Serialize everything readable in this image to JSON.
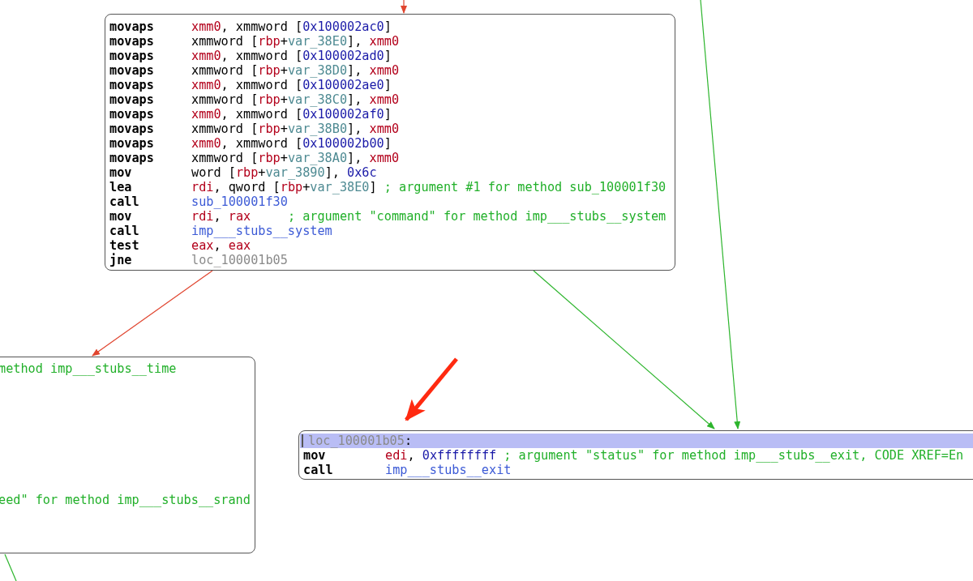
{
  "blocks": [
    {
      "lines": [
        {
          "kind": "instruction",
          "mnemonic": "movaps",
          "operands": [
            {
              "kind": "reg",
              "text": "xmm0"
            },
            {
              "kind": "plain",
              "text": ", xmmword ["
            },
            {
              "kind": "num",
              "text": "0x100002ac0"
            },
            {
              "kind": "plain",
              "text": "]"
            }
          ]
        },
        {
          "kind": "instruction",
          "mnemonic": "movaps",
          "operands": [
            {
              "kind": "plain",
              "text": "xmmword ["
            },
            {
              "kind": "reg",
              "text": "rbp"
            },
            {
              "kind": "plain",
              "text": "+"
            },
            {
              "kind": "var",
              "text": "var_38E0"
            },
            {
              "kind": "plain",
              "text": "], "
            },
            {
              "kind": "reg",
              "text": "xmm0"
            }
          ]
        },
        {
          "kind": "instruction",
          "mnemonic": "movaps",
          "operands": [
            {
              "kind": "reg",
              "text": "xmm0"
            },
            {
              "kind": "plain",
              "text": ", xmmword ["
            },
            {
              "kind": "num",
              "text": "0x100002ad0"
            },
            {
              "kind": "plain",
              "text": "]"
            }
          ]
        },
        {
          "kind": "instruction",
          "mnemonic": "movaps",
          "operands": [
            {
              "kind": "plain",
              "text": "xmmword ["
            },
            {
              "kind": "reg",
              "text": "rbp"
            },
            {
              "kind": "plain",
              "text": "+"
            },
            {
              "kind": "var",
              "text": "var_38D0"
            },
            {
              "kind": "plain",
              "text": "], "
            },
            {
              "kind": "reg",
              "text": "xmm0"
            }
          ]
        },
        {
          "kind": "instruction",
          "mnemonic": "movaps",
          "operands": [
            {
              "kind": "reg",
              "text": "xmm0"
            },
            {
              "kind": "plain",
              "text": ", xmmword ["
            },
            {
              "kind": "num",
              "text": "0x100002ae0"
            },
            {
              "kind": "plain",
              "text": "]"
            }
          ]
        },
        {
          "kind": "instruction",
          "mnemonic": "movaps",
          "operands": [
            {
              "kind": "plain",
              "text": "xmmword ["
            },
            {
              "kind": "reg",
              "text": "rbp"
            },
            {
              "kind": "plain",
              "text": "+"
            },
            {
              "kind": "var",
              "text": "var_38C0"
            },
            {
              "kind": "plain",
              "text": "], "
            },
            {
              "kind": "reg",
              "text": "xmm0"
            }
          ]
        },
        {
          "kind": "instruction",
          "mnemonic": "movaps",
          "operands": [
            {
              "kind": "reg",
              "text": "xmm0"
            },
            {
              "kind": "plain",
              "text": ", xmmword ["
            },
            {
              "kind": "num",
              "text": "0x100002af0"
            },
            {
              "kind": "plain",
              "text": "]"
            }
          ]
        },
        {
          "kind": "instruction",
          "mnemonic": "movaps",
          "operands": [
            {
              "kind": "plain",
              "text": "xmmword ["
            },
            {
              "kind": "reg",
              "text": "rbp"
            },
            {
              "kind": "plain",
              "text": "+"
            },
            {
              "kind": "var",
              "text": "var_38B0"
            },
            {
              "kind": "plain",
              "text": "], "
            },
            {
              "kind": "reg",
              "text": "xmm0"
            }
          ]
        },
        {
          "kind": "instruction",
          "mnemonic": "movaps",
          "operands": [
            {
              "kind": "reg",
              "text": "xmm0"
            },
            {
              "kind": "plain",
              "text": ", xmmword ["
            },
            {
              "kind": "num",
              "text": "0x100002b00"
            },
            {
              "kind": "plain",
              "text": "]"
            }
          ]
        },
        {
          "kind": "instruction",
          "mnemonic": "movaps",
          "operands": [
            {
              "kind": "plain",
              "text": "xmmword ["
            },
            {
              "kind": "reg",
              "text": "rbp"
            },
            {
              "kind": "plain",
              "text": "+"
            },
            {
              "kind": "var",
              "text": "var_38A0"
            },
            {
              "kind": "plain",
              "text": "], "
            },
            {
              "kind": "reg",
              "text": "xmm0"
            }
          ]
        },
        {
          "kind": "instruction",
          "mnemonic": "mov",
          "operands": [
            {
              "kind": "plain",
              "text": "word ["
            },
            {
              "kind": "reg",
              "text": "rbp"
            },
            {
              "kind": "plain",
              "text": "+"
            },
            {
              "kind": "var",
              "text": "var_3890"
            },
            {
              "kind": "plain",
              "text": "], "
            },
            {
              "kind": "num",
              "text": "0x6c"
            }
          ]
        },
        {
          "kind": "instruction",
          "mnemonic": "lea",
          "operands": [
            {
              "kind": "reg",
              "text": "rdi"
            },
            {
              "kind": "plain",
              "text": ", qword ["
            },
            {
              "kind": "reg",
              "text": "rbp"
            },
            {
              "kind": "plain",
              "text": "+"
            },
            {
              "kind": "var",
              "text": "var_38E0"
            },
            {
              "kind": "plain",
              "text": "] "
            },
            {
              "kind": "comment",
              "text": "; argument #1 for method sub_100001f30"
            }
          ]
        },
        {
          "kind": "instruction",
          "mnemonic": "call",
          "operands": [
            {
              "kind": "sym",
              "text": "sub_100001f30"
            }
          ]
        },
        {
          "kind": "instruction",
          "mnemonic": "mov",
          "operands": [
            {
              "kind": "reg",
              "text": "rdi"
            },
            {
              "kind": "plain",
              "text": ", "
            },
            {
              "kind": "reg",
              "text": "rax"
            },
            {
              "kind": "comment",
              "text": "     ; argument \"command\" for method imp___stubs__system"
            }
          ]
        },
        {
          "kind": "instruction",
          "mnemonic": "call",
          "operands": [
            {
              "kind": "sym",
              "text": "imp___stubs__system"
            }
          ]
        },
        {
          "kind": "instruction",
          "mnemonic": "test",
          "operands": [
            {
              "kind": "reg",
              "text": "eax"
            },
            {
              "kind": "plain",
              "text": ", "
            },
            {
              "kind": "reg",
              "text": "eax"
            }
          ]
        },
        {
          "kind": "instruction",
          "mnemonic": "jne",
          "operands": [
            {
              "kind": "label",
              "text": "loc_100001b05"
            }
          ]
        }
      ]
    },
    {
      "lines": [
        {
          "kind": "fragment",
          "operands": [
            {
              "kind": "comment",
              "text": "method imp___stubs__time"
            }
          ]
        },
        {
          "kind": "fragment",
          "operands": [
            {
              "kind": "comment",
              "text": "eed\" for method imp___stubs__srand"
            }
          ]
        }
      ]
    },
    {
      "lines": [
        {
          "kind": "label",
          "operands": [
            {
              "kind": "label",
              "text": "loc_100001b05"
            },
            {
              "kind": "plain",
              "text": ":"
            }
          ]
        },
        {
          "kind": "instruction",
          "mnemonic": "mov",
          "operands": [
            {
              "kind": "reg",
              "text": "edi"
            },
            {
              "kind": "plain",
              "text": ", "
            },
            {
              "kind": "num",
              "text": "0xffffffff"
            },
            {
              "kind": "comment",
              "text": " ; argument \"status\" for method imp___stubs__exit, CODE XREF=En"
            }
          ]
        },
        {
          "kind": "instruction",
          "mnemonic": "call",
          "operands": [
            {
              "kind": "sym",
              "text": "imp___stubs__exit"
            }
          ]
        }
      ]
    }
  ]
}
